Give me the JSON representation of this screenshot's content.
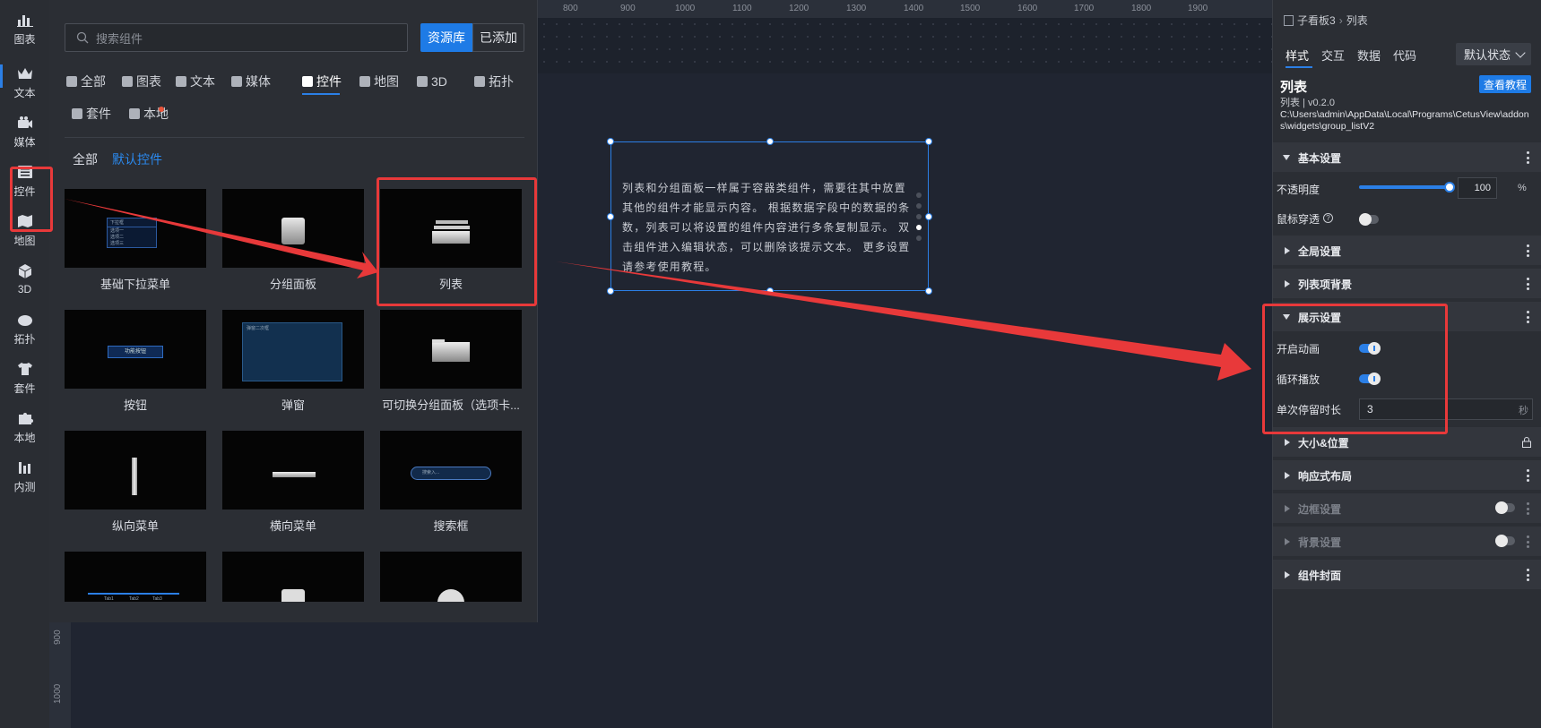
{
  "rail": {
    "items": [
      {
        "label": "图表",
        "icon": "bar-chart-icon"
      },
      {
        "label": "文本",
        "icon": "crown-icon"
      },
      {
        "label": "媒体",
        "icon": "camera-icon"
      },
      {
        "label": "控件",
        "icon": "widget-list-icon"
      },
      {
        "label": "地图",
        "icon": "map-icon"
      },
      {
        "label": "3D",
        "icon": "cube-icon"
      },
      {
        "label": "拓扑",
        "icon": "cloud-icon"
      },
      {
        "label": "套件",
        "icon": "shirt-icon"
      },
      {
        "label": "本地",
        "icon": "puzzle-icon"
      },
      {
        "label": "内测",
        "icon": "flask-icon"
      }
    ]
  },
  "panel": {
    "search_placeholder": "搜索组件",
    "btn_library": "资源库",
    "btn_added": "已添加",
    "categories": [
      "全部",
      "图表",
      "文本",
      "媒体",
      "控件",
      "地图",
      "3D",
      "拓扑",
      "套件",
      "本地"
    ],
    "active_category": "控件",
    "sub_all": "全部",
    "sub_default": "默认控件",
    "cards": [
      {
        "label": "基础下拉菜单",
        "preview": "下拉框"
      },
      {
        "label": "分组面板",
        "preview": ""
      },
      {
        "label": "列表",
        "preview": ""
      },
      {
        "label": "按钮",
        "preview": "功能按钮"
      },
      {
        "label": "弹窗",
        "preview": "弹窗二次框"
      },
      {
        "label": "可切换分组面板（选项卡...",
        "preview": ""
      },
      {
        "label": "纵向菜单",
        "preview": ""
      },
      {
        "label": "横向菜单",
        "preview": ""
      },
      {
        "label": "搜索框",
        "preview": "搜索入..."
      },
      {
        "label": "",
        "preview": ""
      },
      {
        "label": "",
        "preview": ""
      },
      {
        "label": "",
        "preview": ""
      }
    ],
    "dropdown_preview_items": [
      "选项一",
      "选项二",
      "选项三"
    ],
    "slider_preview_ticks": [
      "Tab1",
      "Tab2",
      "Tab3"
    ]
  },
  "ruler": {
    "top_labels": [
      "800",
      "900",
      "1000",
      "1100",
      "1200",
      "1300",
      "1400",
      "1500",
      "1600",
      "1700",
      "1800",
      "1900"
    ],
    "left_labels": [
      "900",
      "1000"
    ]
  },
  "widget": {
    "text": "列表和分组面板一样属于容器类组件，需要往其中放置其他的组件才能显示内容。 根据数据字段中的数据的条数，列表可以将设置的组件内容进行多条复制显示。 双击组件进入编辑状态，可以删除该提示文本。 更多设置请参考使用教程。"
  },
  "props": {
    "breadcrumb_parent": "子看板3",
    "breadcrumb_current": "列表",
    "tabs": [
      "样式",
      "交互",
      "数据",
      "代码"
    ],
    "state_dropdown": "默认状态",
    "title": "列表",
    "tutorial_btn": "查看教程",
    "version": "列表 | v0.2.0",
    "path": "C:\\Users\\admin\\AppData\\Local\\Programs\\CetusView\\addons\\widgets\\group_listV2",
    "sections": {
      "basic": "基本设置",
      "global": "全局设置",
      "item_bg": "列表项背景",
      "display": "展示设置",
      "size_pos": "大小&位置",
      "responsive": "响应式布局",
      "border": "边框设置",
      "background": "背景设置",
      "cover": "组件封面"
    },
    "opacity_label": "不透明度",
    "opacity_value": "100",
    "opacity_unit": "%",
    "mouse_through_label": "鼠标穿透",
    "help_glyph": "?",
    "enable_anim_label": "开启动画",
    "loop_label": "循环播放",
    "stay_label": "单次停留时长",
    "stay_value": "3",
    "stay_unit": "秒",
    "accent_color": "#1e7be6",
    "annotation_color": "#e8393a"
  }
}
